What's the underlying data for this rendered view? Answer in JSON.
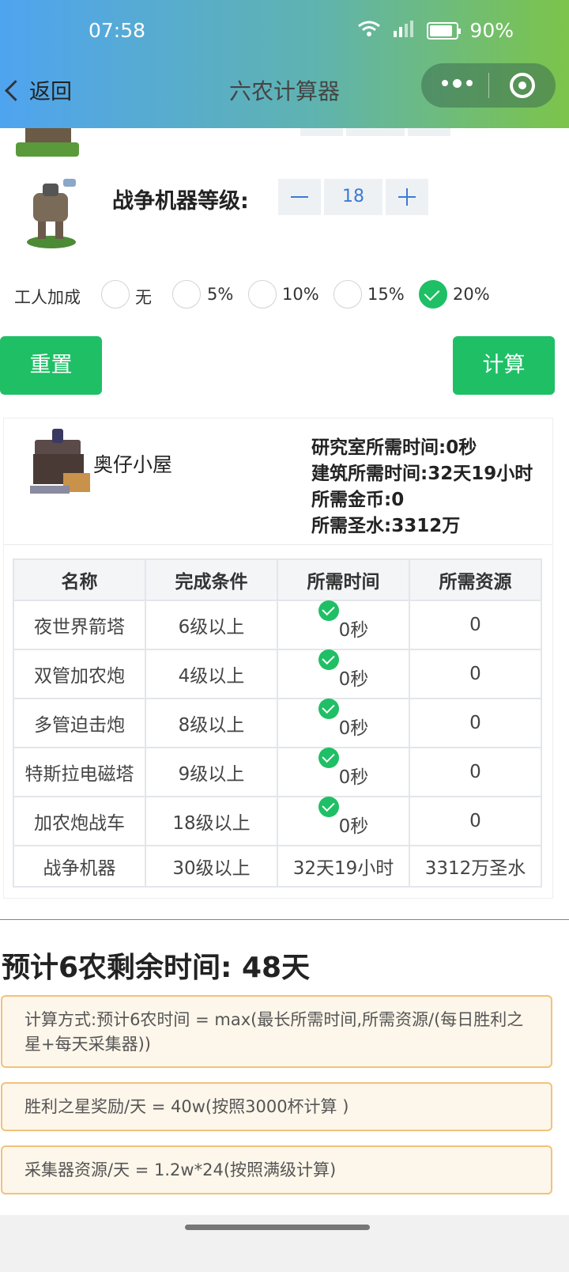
{
  "status": {
    "time": "07:58",
    "battery": "90%"
  },
  "header": {
    "back_label": "返回",
    "title": "六农计算器"
  },
  "machine": {
    "label": "战争机器等级:",
    "level": "18"
  },
  "workers": {
    "label": "工人加成",
    "options": [
      {
        "label": "无",
        "checked": false
      },
      {
        "label": "5%",
        "checked": false
      },
      {
        "label": "10%",
        "checked": false
      },
      {
        "label": "15%",
        "checked": false
      },
      {
        "label": "20%",
        "checked": true
      }
    ]
  },
  "actions": {
    "reset": "重置",
    "calculate": "计算"
  },
  "result": {
    "name": "奥仔小屋",
    "lab_time": "研究室所需时间:0秒",
    "build_time": "建筑所需时间:32天19小时",
    "gold": "所需金币:0",
    "elixir": "所需圣水:3312万"
  },
  "table": {
    "headers": [
      "名称",
      "完成条件",
      "所需时间",
      "所需资源"
    ],
    "rows": [
      {
        "name": "夜世界箭塔",
        "cond": "6级以上",
        "time": "0秒",
        "done": true,
        "res": "0"
      },
      {
        "name": "双管加农炮",
        "cond": "4级以上",
        "time": "0秒",
        "done": true,
        "res": "0"
      },
      {
        "name": "多管迫击炮",
        "cond": "8级以上",
        "time": "0秒",
        "done": true,
        "res": "0"
      },
      {
        "name": "特斯拉电磁塔",
        "cond": "9级以上",
        "time": "0秒",
        "done": true,
        "res": "0"
      },
      {
        "name": "加农炮战车",
        "cond": "18级以上",
        "time": "0秒",
        "done": true,
        "res": "0"
      },
      {
        "name": "战争机器",
        "cond": "30级以上",
        "time": "32天19小时",
        "done": false,
        "res": "3312万圣水"
      }
    ]
  },
  "estimate": "预计6农剩余时间: 48天",
  "notes": [
    "计算方式:预计6农时间 = max(最长所需时间,所需资源/(每日胜利之星+每天采集器))",
    "胜利之星奖励/天 = 40w(按照3000杯计算 )",
    "采集器资源/天 = 1.2w*24(按照满级计算)"
  ],
  "colors": {
    "accent_green": "#1fbf66",
    "stepper_blue": "#3a7bd5",
    "note_border": "#f2c27a"
  }
}
